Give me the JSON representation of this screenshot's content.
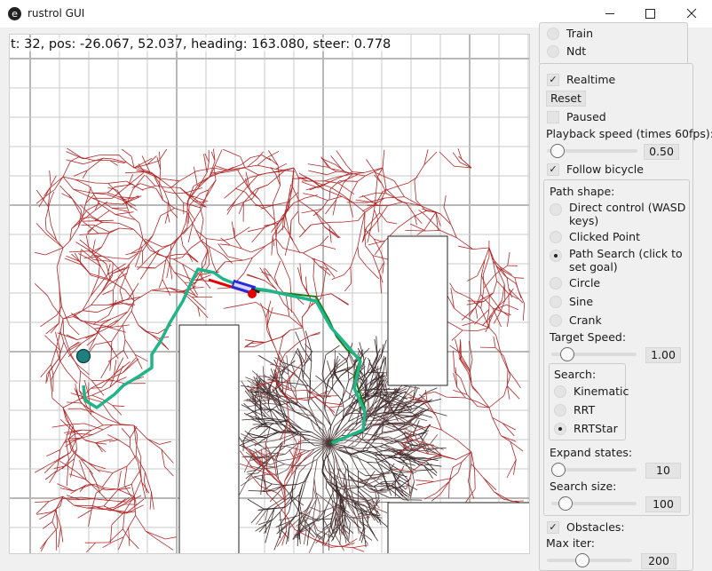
{
  "window": {
    "title": "rustrol GUI",
    "icon": "e"
  },
  "status": "t: 32, pos: -26.067, 52.037, heading: 163.080, steer: 0.778",
  "mode": {
    "items": [
      {
        "label": "Train"
      },
      {
        "label": "Ndt"
      }
    ]
  },
  "controls": {
    "realtime": "Realtime",
    "reset": "Reset",
    "paused": "Paused",
    "playback_label": "Playback speed (times 60fps):",
    "playback_value": "0.50",
    "playback_fraction": 0.05,
    "follow": "Follow bicycle"
  },
  "path_shape": {
    "title": "Path shape:",
    "options": [
      {
        "label": "Direct control (WASD keys)"
      },
      {
        "label": "Clicked Point"
      },
      {
        "label": "Path Search (click to set goal)"
      },
      {
        "label": "Circle"
      },
      {
        "label": "Sine"
      },
      {
        "label": "Crank"
      }
    ],
    "selected": 2,
    "target_speed_label": "Target Speed:",
    "target_speed_value": "1.00",
    "target_speed_fraction": 0.12
  },
  "search": {
    "title": "Search:",
    "options": [
      {
        "label": "Kinematic"
      },
      {
        "label": "RRT"
      },
      {
        "label": "RRTStar"
      }
    ],
    "selected": 2
  },
  "expand": {
    "label": "Expand states:",
    "value": "10",
    "fraction": 0.0
  },
  "search_size": {
    "label": "Search size:",
    "value": "100",
    "fraction": 0.1
  },
  "obstacles": {
    "label": "Obstacles:"
  },
  "max_iter": {
    "label": "Max iter:",
    "value": "200"
  },
  "colors": {
    "tree_red": "#b02828",
    "tree_dark": "#3a2a2a",
    "path_teal": "#1fb589",
    "path_green": "#1a7a1a",
    "grid": "#c8c8c8"
  }
}
